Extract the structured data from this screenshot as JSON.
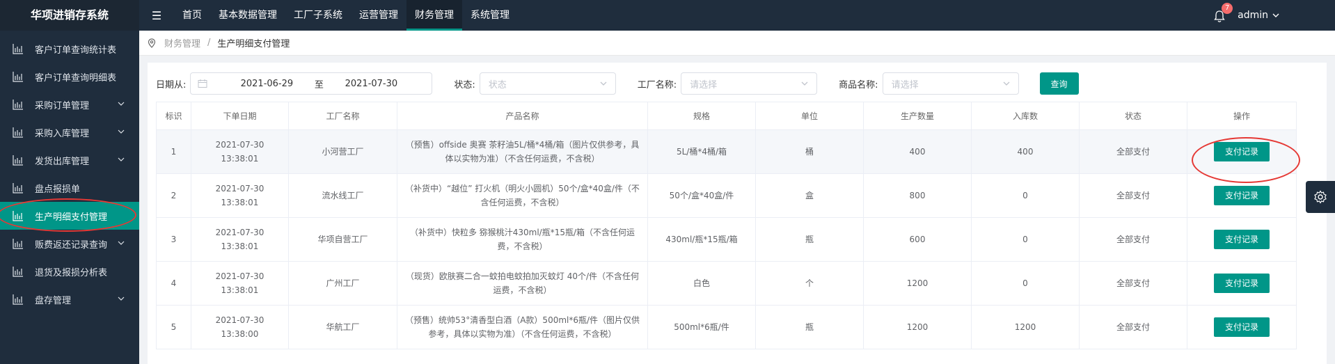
{
  "app": {
    "title": "华项进销存系统"
  },
  "sidebar": {
    "items": [
      {
        "label": "客户订单查询统计表",
        "expandable": false,
        "active": false
      },
      {
        "label": "客户订单查询明细表",
        "expandable": false,
        "active": false
      },
      {
        "label": "采购订单管理",
        "expandable": true,
        "active": false
      },
      {
        "label": "采购入库管理",
        "expandable": true,
        "active": false
      },
      {
        "label": "发货出库管理",
        "expandable": true,
        "active": false
      },
      {
        "label": "盘点报损单",
        "expandable": false,
        "active": false
      },
      {
        "label": "生产明细支付管理",
        "expandable": false,
        "active": true
      },
      {
        "label": "贩费返还记录查询",
        "expandable": true,
        "active": false
      },
      {
        "label": "退货及报损分析表",
        "expandable": false,
        "active": false
      },
      {
        "label": "盘存管理",
        "expandable": true,
        "active": false
      }
    ]
  },
  "topnav": {
    "items": [
      {
        "label": "首页",
        "active": false
      },
      {
        "label": "基本数据管理",
        "active": false
      },
      {
        "label": "工厂子系统",
        "active": false
      },
      {
        "label": "运营管理",
        "active": false
      },
      {
        "label": "财务管理",
        "active": true
      },
      {
        "label": "系统管理",
        "active": false
      }
    ],
    "notification_count": "7",
    "user": "admin"
  },
  "breadcrumb": {
    "first": "财务管理",
    "separator": "/",
    "current": "生产明细支付管理"
  },
  "filters": {
    "date_label": "日期从:",
    "date_from": "2021-06-29",
    "date_sep": "至",
    "date_to": "2021-07-30",
    "status_label": "状态:",
    "status_placeholder": "状态",
    "factory_label": "工厂名称:",
    "factory_placeholder": "请选择",
    "product_label": "商品名称:",
    "product_placeholder": "请选择",
    "query_button": "查询"
  },
  "table": {
    "headers": [
      "标识",
      "下单日期",
      "工厂名称",
      "产品名称",
      "规格",
      "单位",
      "生产数量",
      "入库数",
      "状态",
      "操作"
    ],
    "rows": [
      {
        "id": "1",
        "date": "2021-07-30 13:38:01",
        "factory": "小河营工厂",
        "product": "（预售）offside 奥赛 茶籽油5L/桶*4桶/箱（图片仅供参考，具体以实物为准）（不含任何运费，不含税）",
        "spec": "5L/桶*4桶/箱",
        "unit": "桶",
        "qty": "400",
        "stock": "400",
        "status": "全部支付",
        "action": "支付记录"
      },
      {
        "id": "2",
        "date": "2021-07-30 13:38:01",
        "factory": "流水线工厂",
        "product": "（补货中）“越位” 打火机（明火小圆机）50个/盒*40盒/件（不含任何运费，不含税）",
        "spec": "50个/盒*40盒/件",
        "unit": "盒",
        "qty": "800",
        "stock": "0",
        "status": "全部支付",
        "action": "支付记录"
      },
      {
        "id": "3",
        "date": "2021-07-30 13:38:01",
        "factory": "华项自营工厂",
        "product": "（补货中）快粒多 猕猴桃汁430ml/瓶*15瓶/箱（不含任何运费，不含税）",
        "spec": "430ml/瓶*15瓶/箱",
        "unit": "瓶",
        "qty": "600",
        "stock": "0",
        "status": "全部支付",
        "action": "支付记录"
      },
      {
        "id": "4",
        "date": "2021-07-30 13:38:01",
        "factory": "广州工厂",
        "product": "（现货）欧肤赛二合一蚊拍电蚊拍加灭蚊灯 40个/件（不含任何运费，不含税）",
        "spec": "白色",
        "unit": "个",
        "qty": "1200",
        "stock": "0",
        "status": "全部支付",
        "action": "支付记录"
      },
      {
        "id": "5",
        "date": "2021-07-30 13:38:00",
        "factory": "华航工厂",
        "product": "（预售）统帅53°清香型白酒（A款）500ml*6瓶/件（图片仅供参考，具体以实物为准）（不含任何运费，不含税）",
        "spec": "500ml*6瓶/件",
        "unit": "瓶",
        "qty": "1200",
        "stock": "1200",
        "status": "全部支付",
        "action": "支付记录"
      }
    ]
  },
  "colors": {
    "accent": "#009688",
    "sidebar_bg": "#1f2d3d",
    "annotation": "#e53935"
  }
}
